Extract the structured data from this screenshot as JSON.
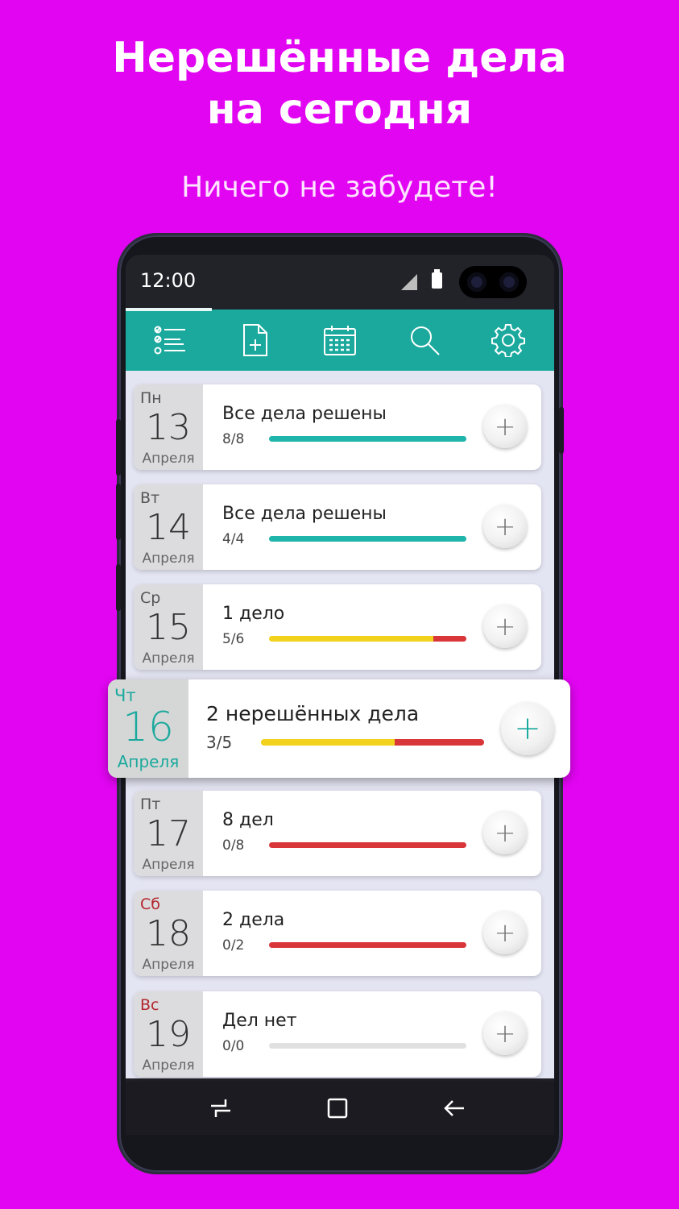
{
  "promo": {
    "headline_line1": "Нерешённые дела",
    "headline_line2": "на сегодня",
    "subline": "Ничего не забудете!"
  },
  "status_bar": {
    "time": "12:00"
  },
  "toolbar": {
    "tabs": [
      {
        "icon": "task-list-icon",
        "active": true
      },
      {
        "icon": "new-document-icon",
        "active": false
      },
      {
        "icon": "calendar-icon",
        "active": false
      },
      {
        "icon": "search-icon",
        "active": false
      },
      {
        "icon": "settings-gear-icon",
        "active": false
      }
    ]
  },
  "colors": {
    "background": "#e205f2",
    "accent_teal": "#1ba99d",
    "progress_done": "#1fb5ab",
    "progress_partial": "#f2d21c",
    "progress_pending": "#d9363a",
    "weekend_red": "#b3262d"
  },
  "days": [
    {
      "dow": "Пн",
      "day": "13",
      "month": "Апреля",
      "title": "Все дела решены",
      "count": "8/8",
      "done": 8,
      "total": 8,
      "weekend": false
    },
    {
      "dow": "Вт",
      "day": "14",
      "month": "Апреля",
      "title": "Все дела решены",
      "count": "4/4",
      "done": 4,
      "total": 4,
      "weekend": false
    },
    {
      "dow": "Ср",
      "day": "15",
      "month": "Апреля",
      "title": "1 дело",
      "count": "5/6",
      "done": 5,
      "total": 6,
      "weekend": false
    },
    {
      "dow": "Чт",
      "day": "16",
      "month": "Апреля",
      "title": "2 нерешённых дела",
      "count": "3/5",
      "done": 3,
      "total": 5,
      "weekend": false,
      "today": true
    },
    {
      "dow": "Пт",
      "day": "17",
      "month": "Апреля",
      "title": "8 дел",
      "count": "0/8",
      "done": 0,
      "total": 8,
      "weekend": false
    },
    {
      "dow": "Сб",
      "day": "18",
      "month": "Апреля",
      "title": "2 дела",
      "count": "0/2",
      "done": 0,
      "total": 2,
      "weekend": true
    },
    {
      "dow": "Вс",
      "day": "19",
      "month": "Апреля",
      "title": "Дел нет",
      "count": "0/0",
      "done": 0,
      "total": 0,
      "weekend": true
    }
  ],
  "nav_bar": {
    "buttons": [
      {
        "icon": "recent-apps-icon"
      },
      {
        "icon": "home-square-icon"
      },
      {
        "icon": "back-arrow-icon"
      }
    ]
  },
  "add_glyph": "+"
}
